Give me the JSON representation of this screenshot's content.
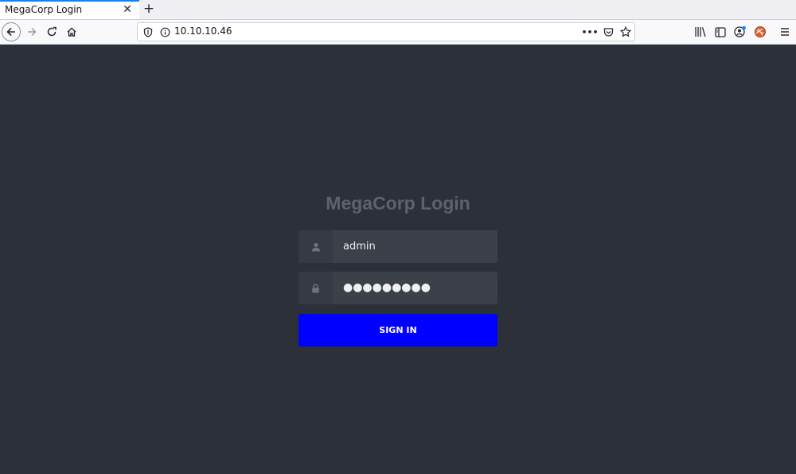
{
  "browser": {
    "tab_title": "MegaCorp Login",
    "tab_close": "✕",
    "new_tab": "+",
    "url": "10.10.10.46",
    "page_actions": "•••"
  },
  "login": {
    "title": "MegaCorp Login",
    "username_value": "admin",
    "password_masked": "●●●●●●●●●",
    "signin_label": "SIGN IN"
  },
  "colors": {
    "page_bg": "#2c3038",
    "signin_bg": "#0000ff",
    "title_color": "#5d626b"
  },
  "icons": {
    "back": "back-arrow-icon",
    "forward": "forward-arrow-icon",
    "reload": "reload-icon",
    "home": "home-icon",
    "shield": "tracking-shield-icon",
    "info": "info-icon",
    "pocket": "pocket-icon",
    "bookmark": "star-icon",
    "library": "library-icon",
    "sidebar": "sidebar-icon",
    "account": "account-icon",
    "extension": "extension-icon",
    "menu": "hamburger-menu-icon",
    "user": "user-icon",
    "lock": "lock-icon"
  }
}
